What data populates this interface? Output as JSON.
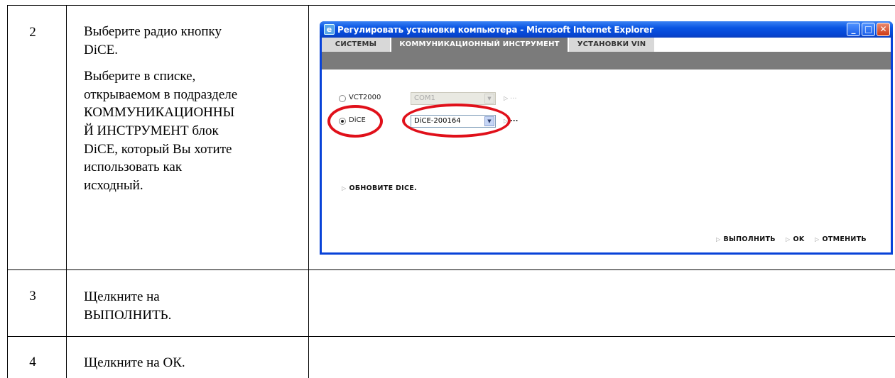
{
  "steps": [
    {
      "number": "2",
      "paragraphs": [
        "Выберите радио кнопку DiCE.",
        "Выберите в списке, открываемом в подразделе КОММУНИКАЦИОННЫ Й ИНСТРУМЕНТ блок DiCE, который Вы хотите использовать как исходный."
      ],
      "lines": [
        [
          "Выберите радио кнопку",
          "DiCE."
        ],
        [
          "Выберите в списке,",
          "открываемом в подразделе",
          "КОММУНИКАЦИОННЫ",
          "Й ИНСТРУМЕНТ блок",
          "DiCE, который Вы хотите",
          "использовать как",
          "исходный."
        ]
      ]
    },
    {
      "number": "3",
      "lines": [
        [
          "Щелкните на",
          "ВЫПОЛНИТЬ."
        ]
      ]
    },
    {
      "number": "4",
      "lines": [
        [
          "Щелкните на ОК."
        ]
      ]
    }
  ],
  "window": {
    "title": "Регулировать установки компьютера - Microsoft Internet Explorer",
    "controls": {
      "minimize": "_",
      "maximize": "□",
      "close": "✕"
    },
    "tabs": [
      {
        "label": "СИСТЕМЫ",
        "active": false
      },
      {
        "label": "КОММУНИКАЦИОННЫЙ ИНСТРУМЕНТ",
        "active": true
      },
      {
        "label": "УСТАНОВКИ VIN",
        "active": false
      }
    ],
    "options": [
      {
        "label": "VCT2000",
        "selected": false,
        "combo_value": "COM1",
        "enabled": false
      },
      {
        "label": "DiCE",
        "selected": true,
        "combo_value": "DiCE-200164",
        "enabled": true
      }
    ],
    "more_button": "...",
    "update_link": "ОБНОВИТЕ DICE.",
    "footer_buttons": [
      "ВЫПОЛНИТЬ",
      "OK",
      "ОТМЕНИТЬ"
    ],
    "highlight_color": "#e0101a"
  }
}
